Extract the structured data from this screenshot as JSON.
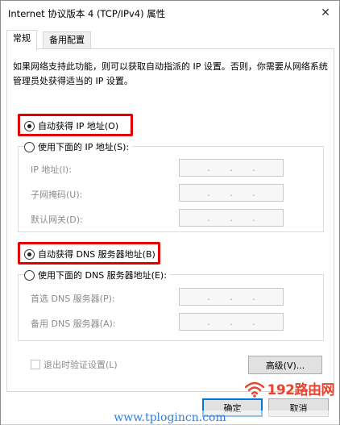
{
  "window": {
    "title": "Internet 协议版本 4 (TCP/IPv4) 属性",
    "close_glyph": "✕"
  },
  "tabs": [
    {
      "label": "常规"
    },
    {
      "label": "备用配置"
    }
  ],
  "description": "如果网络支持此功能，则可以获取自动指派的 IP 设置。否则，你需要从网络系统管理员处获得适当的 IP 设置。",
  "ip_section": {
    "auto_label": "自动获得 IP 地址(O)",
    "manual_label": "使用下面的 IP 地址(S):",
    "fields": [
      {
        "label": "IP 地址(I):"
      },
      {
        "label": "子网掩码(U):"
      },
      {
        "label": "默认网关(D):"
      }
    ]
  },
  "dns_section": {
    "auto_label": "自动获得 DNS 服务器地址(B)",
    "manual_label": "使用下面的 DNS 服务器地址(E):",
    "fields": [
      {
        "label": "首选 DNS 服务器(P):"
      },
      {
        "label": "备用 DNS 服务器(A):"
      }
    ]
  },
  "ip_dot": ".",
  "validate_on_exit_label": "退出时验证设置(L)",
  "advanced_button": "高级(V)...",
  "ok_button": "确定",
  "cancel_button": "取消",
  "watermark": {
    "brand": "192路由网",
    "url": "www.tplogincn.com"
  },
  "colors": {
    "highlight": "#e00000",
    "watermark_brand": "#e8442f",
    "watermark_url": "#2f7fe0"
  }
}
